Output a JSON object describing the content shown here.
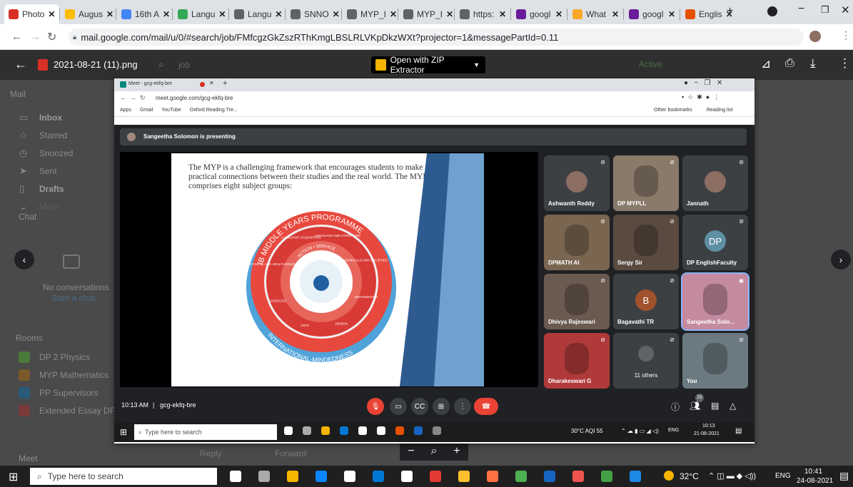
{
  "browser": {
    "tabs": [
      {
        "label": "Photo",
        "color": "#d93025"
      },
      {
        "label": "Augus",
        "color": "#fbbc04"
      },
      {
        "label": "16th A",
        "color": "#4285f4"
      },
      {
        "label": "Langu",
        "color": "#34a853"
      },
      {
        "label": "Langu",
        "color": "#5f6368"
      },
      {
        "label": "SNNO",
        "color": "#5f6368"
      },
      {
        "label": "MYP_I",
        "color": "#5f6368"
      },
      {
        "label": "MYP_I",
        "color": "#5f6368"
      },
      {
        "label": "https:",
        "color": "#5f6368"
      },
      {
        "label": "googl",
        "color": "#6a1b9a"
      },
      {
        "label": "What",
        "color": "#f9a825"
      },
      {
        "label": "googl",
        "color": "#6a1b9a"
      },
      {
        "label": "Englis",
        "color": "#e65100"
      }
    ],
    "new_tab": "+",
    "url": "mail.google.com/mail/u/0/#search/job/FMfcgzGkZszRThKmgLBSLRLVKpDkzWXt?projector=1&messagePartId=0.11"
  },
  "viewer": {
    "filename": "2021-08-21 (11).png",
    "open_with": "Open with ZIP Extractor",
    "search_text": "job",
    "status": "Active",
    "reply": "Reply",
    "forward": "Forward",
    "zoom_minus": "−",
    "zoom_plus": "+"
  },
  "gmail_sidebar": {
    "mail": "Mail",
    "items": [
      "Inbox",
      "Starred",
      "Snoozed",
      "Sent",
      "Drafts",
      "More"
    ],
    "chat": "Chat",
    "no_conv": "No conversations",
    "start_chat": "Start a chat",
    "rooms": "Rooms",
    "room_items": [
      "DP 2 Physics",
      "MYP Mathematics",
      "PP Supervisors",
      "Extended Essay DP2"
    ],
    "meet": "Meet"
  },
  "screenshot": {
    "meet_tab": "Meet - gcg-ekfq-bre",
    "meet_url": "meet.google.com/gcg-ekfq-bre",
    "bookmarks": [
      "Apps",
      "Gmail",
      "YouTube",
      "Oxford Reading Tre..."
    ],
    "other_bookmarks": "Other bookmarks",
    "reading_list": "Reading list",
    "presenting": "Sangeetha Solomon is presenting",
    "slide_text": "The MYP is a challenging framework that encourages students to make practical connections between their studies and the real world. The MYP comprises eight subject groups:",
    "wheel": {
      "outer": "IB MIDDLE YEARS PROGRAMME",
      "bottom": "INTERNATIONAL-MINDEDNESS",
      "ring": "COMMUNITY PROJECT • PERSONAL PROJECT",
      "top": "ACTION • SERVICE",
      "subjects": [
        "LANGUAGE AND LITERATURE",
        "INDIVIDUALS AND SOCIETIES",
        "MATHEMATICS",
        "DESIGN",
        "ARTS",
        "SCIENCES",
        "PHYSICAL AND HEALTH EDUCATION",
        "LANGUAGE ACQUISITION"
      ]
    },
    "participants": [
      {
        "name": "Ashwanth Reddy",
        "kind": "avatar"
      },
      {
        "name": "DP MYPLL",
        "kind": "video"
      },
      {
        "name": "Jannath",
        "kind": "avatar"
      },
      {
        "name": "DPMATH Al",
        "kind": "video"
      },
      {
        "name": "Sergy Sir",
        "kind": "video"
      },
      {
        "name": "DP EnglishFaculty",
        "kind": "initials",
        "initials": "DP"
      },
      {
        "name": "Dhivya Rajeswari",
        "kind": "video"
      },
      {
        "name": "Bagavathi TR",
        "kind": "initials",
        "initials": "B"
      },
      {
        "name": "Sangeetha Solo...",
        "kind": "video"
      },
      {
        "name": "Dharakeswari G",
        "kind": "video"
      },
      {
        "name": "11 others",
        "kind": "others"
      },
      {
        "name": "You",
        "kind": "video"
      }
    ],
    "time": "10:13 AM",
    "meeting_code": "gcg-ekfq-bre",
    "people_count": "23",
    "inner_search": "Type here to search",
    "inner_weather": "30°C AQI 55",
    "inner_lang": "ENG",
    "inner_clock": "10:13",
    "inner_date": "21-08-2021"
  },
  "taskbar": {
    "search": "Type here to search",
    "weather": "32°C",
    "lang": "ENG",
    "time": "10:41",
    "date": "24-08-2021"
  }
}
